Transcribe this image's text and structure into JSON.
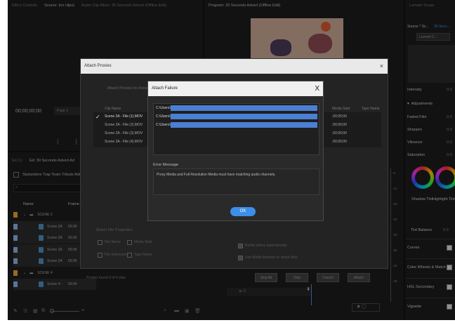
{
  "tabs": {
    "effect_controls": "Effect Controls",
    "source": "Source: (no clips)",
    "audio_mixer": "Audio Clip Mixer: 30 Seconds Advert (Offline Edit)",
    "program": "Program: 30 Seconds Advert (Offline Edit)",
    "lumetri_scopes": "Lumetri Scope"
  },
  "source_panel": {
    "timecode": "00;00;00;00",
    "page": "Page 1"
  },
  "project_panel": {
    "tab_a": "Ed (1)",
    "tab_b": "Ed: 30 Seconds Advert Ad",
    "project_name": "Skylanders Trap Team Tribute Adv",
    "col_name": "Name",
    "col_frame": "Frame",
    "items": [
      {
        "label": "SCENE 2",
        "type": "bin",
        "color": "#e8a33a"
      },
      {
        "label": "Scene 2A",
        "frame": "59;96",
        "type": "clip"
      },
      {
        "label": "Scene 2A",
        "frame": "59;96",
        "type": "clip"
      },
      {
        "label": "Scene 2A",
        "frame": "59;96",
        "type": "clip"
      },
      {
        "label": "Scene 2A",
        "frame": "59;96",
        "type": "clip"
      },
      {
        "label": "SCENE 4",
        "type": "bin",
        "color": "#e8a33a"
      },
      {
        "label": "Scene 4 -",
        "frame": "59;94",
        "type": "clip"
      }
    ]
  },
  "lumetri": {
    "source": "Source * Sc...",
    "seq": "30 Seco...",
    "lut": "Lumetri C...",
    "intensity": "Intensity",
    "intensity_val": "0.0",
    "adjustments": "Adjustments",
    "faded_film": "Faded Film",
    "sharpen": "Sharpen",
    "vibrance": "Vibrance",
    "saturation": "Saturation",
    "val": "0.0",
    "shadow_tint": "Shadow Tint",
    "highlight_tint": "Highlight Tint",
    "tint_balance": "Tint Balance",
    "tint_val": "0.0",
    "sections": [
      "Curves",
      "Color Wheels & Match",
      "HSL Secondary",
      "Vignette"
    ]
  },
  "attach_proxies": {
    "title": "Attach Proxies",
    "prompt": "Attach Proxies for these clips:",
    "col_clip": "Clip Name",
    "col_start": "Media Start",
    "col_type": "Tape Name",
    "clips": [
      "Scene 2A - File (1).MOV",
      "Scene 2A - File (2).MOV",
      "Scene 2A - File (3).MOV",
      "Scene 2A - File (4).MOV"
    ],
    "starts": [
      ";00;00;00",
      ";00;00;00",
      ";00;00;00",
      ";00;00;00"
    ],
    "match_props": "Match File Properties",
    "file_name": "File Name",
    "media_start": "Media Start",
    "file_ext": "File Extension",
    "tape_name": "Tape Name",
    "relink_others": "Relink others automatically",
    "use_browser": "Use Media Browser to attach files",
    "status": "Proxies found 0 of 4 clips",
    "buttons": [
      "Skip All",
      "Skip",
      "Cancel",
      "Attach"
    ]
  },
  "failure": {
    "title": "Attach Failure",
    "close": "X",
    "paths": [
      "C:\\Users\\",
      "C:\\Users\\",
      "C:\\Users\\"
    ],
    "error_label": "Error Message",
    "error_text": "Proxy Media and Full Resolution Media must have matching audio channels.",
    "ok": "OK"
  },
  "ruler": [
    "-6",
    "-12",
    "-18",
    "-24",
    "-30",
    "-36",
    "-42",
    "-48"
  ]
}
